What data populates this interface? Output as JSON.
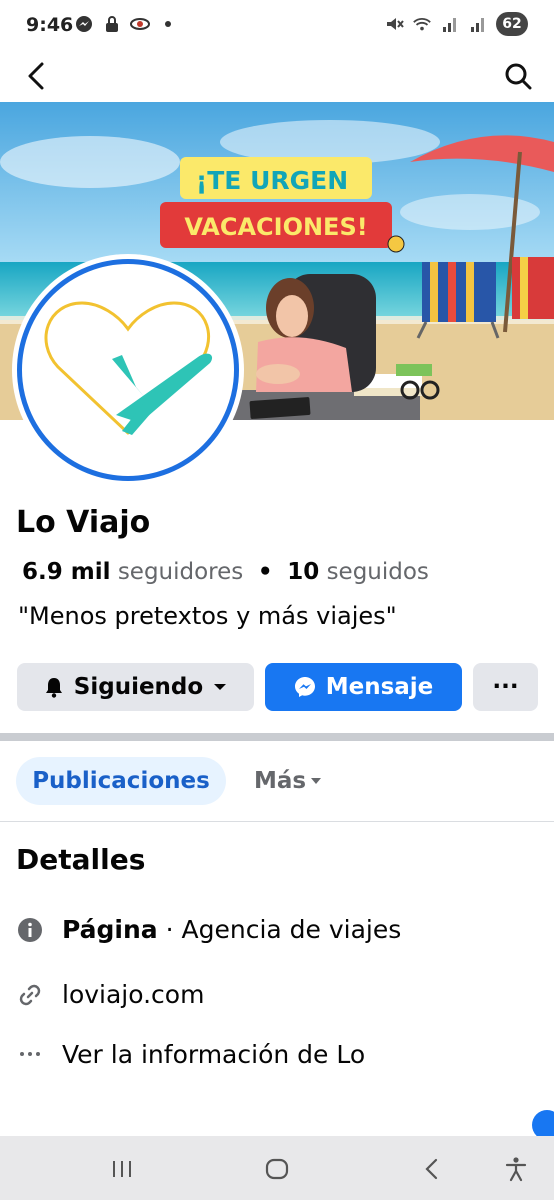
{
  "status_bar": {
    "time": "9:46",
    "battery": "62"
  },
  "cover": {
    "headline_line1": "¡TE URGEN",
    "headline_line2": "VACACIONES!",
    "colors": {
      "sky": "#5fb8e8",
      "sea": "#1fb3c5",
      "sand": "#e8cf9c",
      "headline_bg1": "#fbe96a",
      "headline_bg2": "#e23a3a"
    }
  },
  "profile": {
    "name": "Lo Viajo",
    "followers_count": "6.9 mil",
    "followers_label": "seguidores",
    "separator": "•",
    "following_count": "10",
    "following_label": "seguidos",
    "bio": "\"Menos pretextos y más viajes\""
  },
  "actions": {
    "follow_label": "Siguiendo",
    "message_label": "Mensaje",
    "more_label": "···"
  },
  "tabs": {
    "active": "Publicaciones",
    "more": "Más"
  },
  "details": {
    "title": "Detalles",
    "page_label": "Página",
    "page_sep": "·",
    "category": "Agencia de viajes",
    "website": "loviajo.com",
    "see_info": "Ver la información de Lo"
  },
  "colors": {
    "accent": "#1877f2",
    "button_gray": "#e4e6eb",
    "tab_bg": "#e7f3ff",
    "logo_heart": "#f2c230",
    "logo_plane": "#2ec4b6"
  },
  "icons": {
    "back": "chevron-left-icon",
    "search": "search-icon",
    "bell": "bell-icon",
    "messenger": "messenger-icon",
    "info": "info-icon",
    "link": "link-icon",
    "dots": "more-horizontal-icon"
  }
}
